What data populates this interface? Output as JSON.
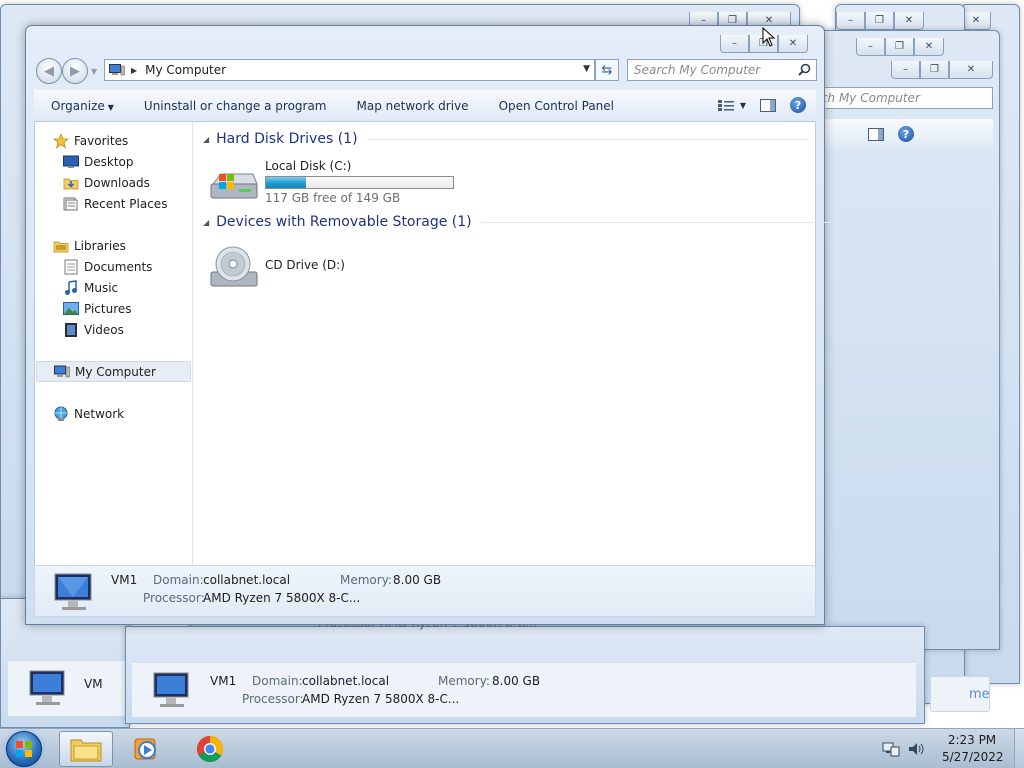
{
  "window": {
    "title": "My Computer",
    "address": "My Computer",
    "search_placeholder": "Search My Computer"
  },
  "toolbar": {
    "organize": "Organize",
    "uninstall": "Uninstall or change a program",
    "map_drive": "Map network drive",
    "control_panel": "Open Control Panel"
  },
  "nav": {
    "favorites": "Favorites",
    "desktop": "Desktop",
    "downloads": "Downloads",
    "recent": "Recent Places",
    "libraries": "Libraries",
    "documents": "Documents",
    "music": "Music",
    "pictures": "Pictures",
    "videos": "Videos",
    "computer": "My Computer",
    "network": "Network"
  },
  "groups": {
    "hdd": "Hard Disk Drives (1)",
    "removable": "Devices with Removable Storage (1)"
  },
  "drives": {
    "c_name": "Local Disk (C:)",
    "c_free": "117 GB free of 149 GB",
    "c_used_fraction": 0.215,
    "d_name": "CD Drive (D:)"
  },
  "details": {
    "name": "VM1",
    "domain_label": "Domain:",
    "domain": "collabnet.local",
    "memory_label": "Memory:",
    "memory": "8.00 GB",
    "processor_label": "Processor:",
    "processor": "AMD Ryzen 7 5800X 8-C..."
  },
  "background": {
    "search_partial": "rch My Computer",
    "details_name_partial": "VM",
    "processor_partial": "Processor AMD Ryzen 7 5800X 8-C...",
    "right_partial": "me"
  },
  "taskbar": {
    "time": "2:23 PM",
    "date": "5/27/2022"
  },
  "colors": {
    "accent": "#1e3287",
    "progress": "#1f9dd0",
    "taskbar": "#b8cade"
  }
}
